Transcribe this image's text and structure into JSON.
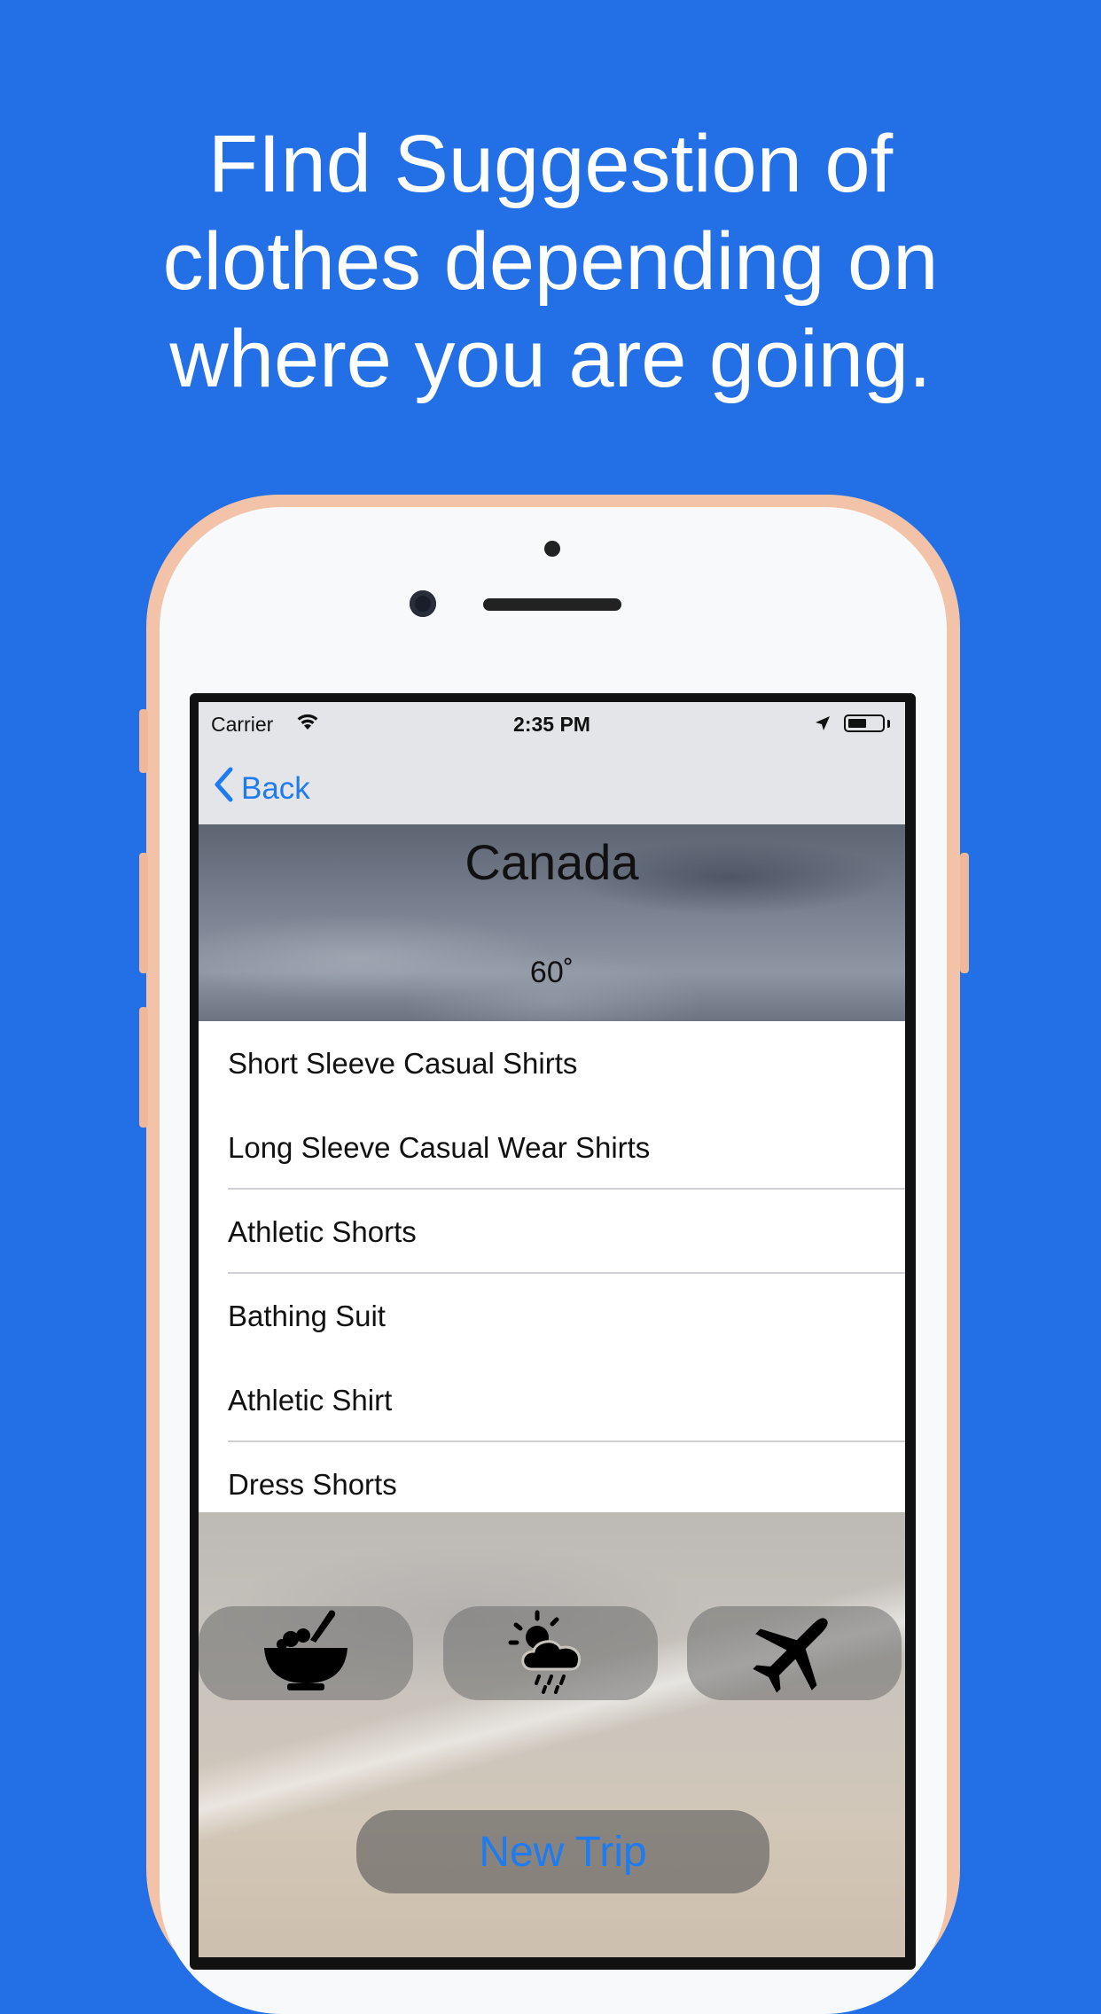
{
  "headline": {
    "lines": [
      "FInd Suggestion of",
      "clothes depending on",
      "where you are going."
    ]
  },
  "status_bar": {
    "carrier": "Carrier",
    "time": "2:35 PM",
    "battery_level": 0.55
  },
  "nav": {
    "back_label": "Back"
  },
  "destination": {
    "country": "Canada",
    "temperature": "60˚"
  },
  "clothing_list": [
    {
      "label": "Short Sleeve Casual Shirts",
      "separator": false
    },
    {
      "label": "Long Sleeve Casual Wear Shirts",
      "separator": true
    },
    {
      "label": "Athletic Shorts",
      "separator": true
    },
    {
      "label": "Bathing Suit",
      "separator": false
    },
    {
      "label": "Athletic Shirt",
      "separator": true
    },
    {
      "label": "Dress Shorts",
      "separator": false
    }
  ],
  "toolbar": {
    "buttons": [
      {
        "icon": "food-bowl-icon"
      },
      {
        "icon": "weather-icon"
      },
      {
        "icon": "airplane-icon"
      }
    ],
    "new_trip_label": "New Trip"
  },
  "colors": {
    "background": "#2370E6",
    "accent": "#1E7BF0",
    "phone_frame": "#F2C3A8"
  }
}
